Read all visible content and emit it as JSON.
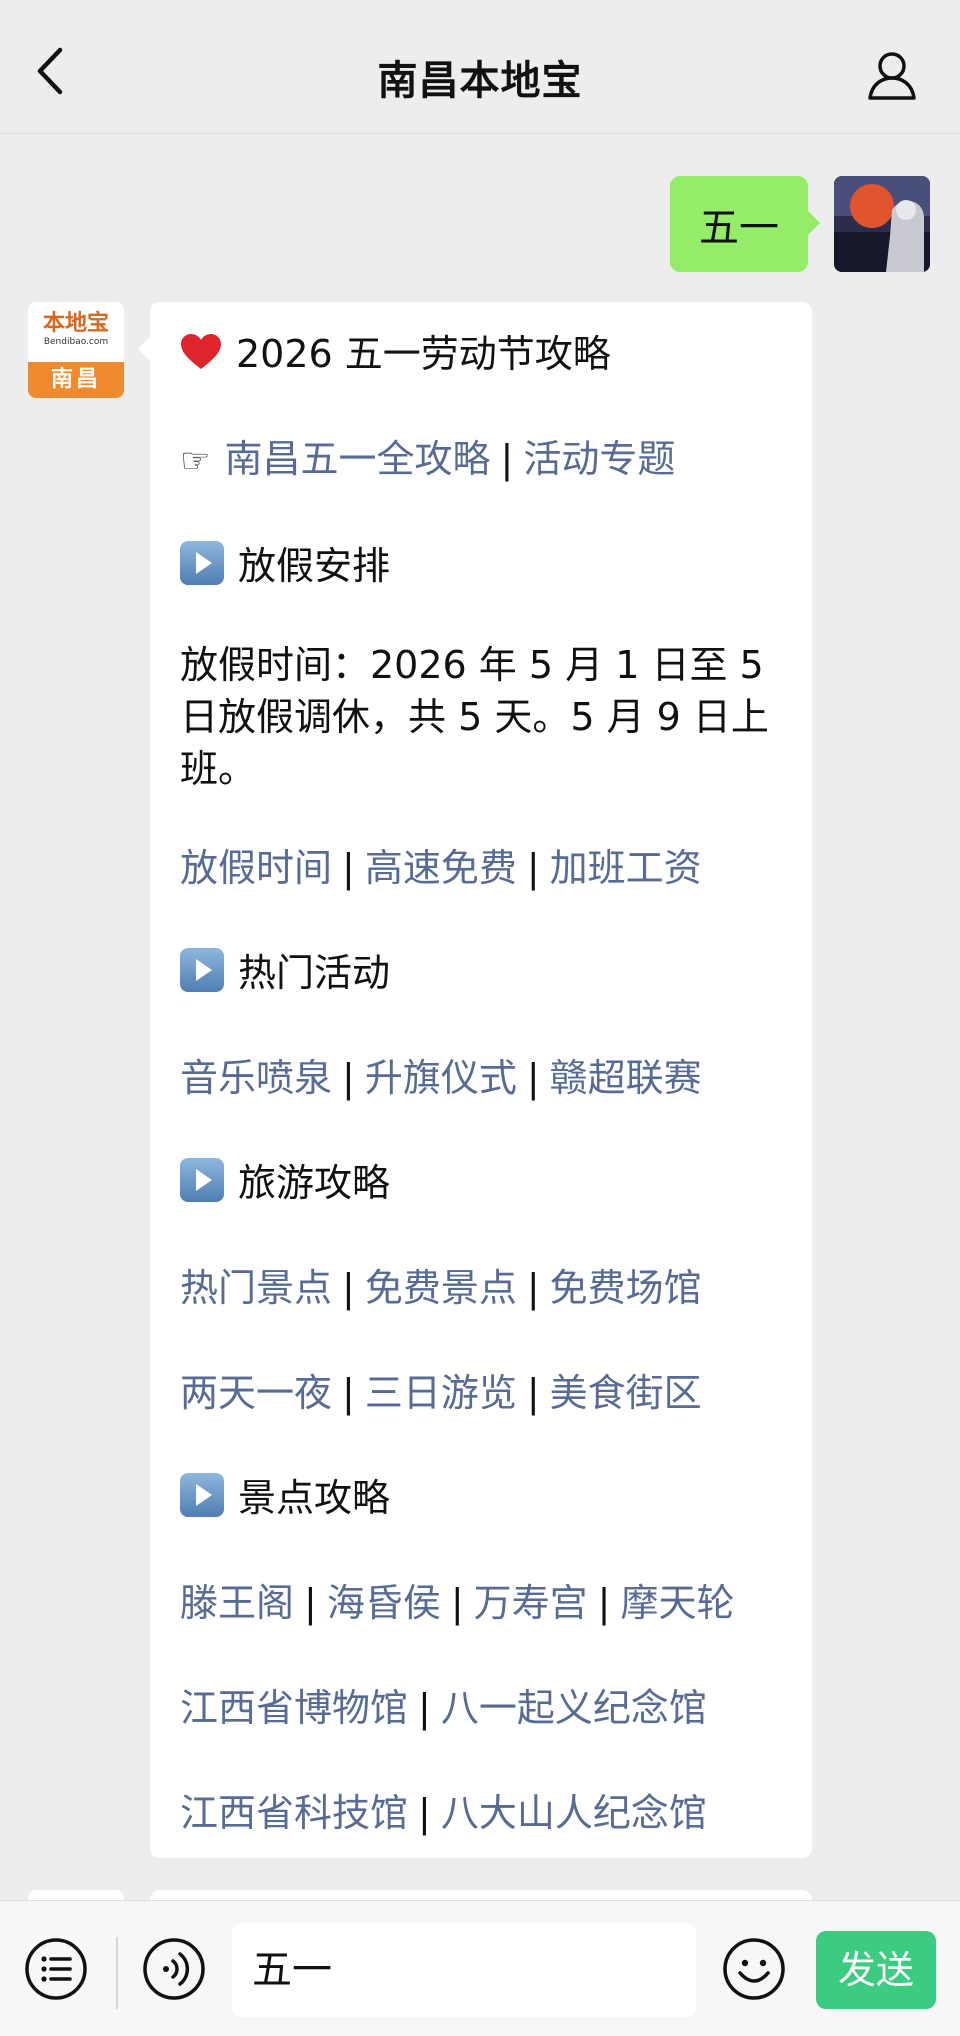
{
  "header": {
    "title": "南昌本地宝",
    "back_icon": "chevron-left-icon",
    "profile_icon": "person-icon"
  },
  "chat": {
    "user_message": {
      "text": "五一"
    },
    "bot_avatar": {
      "brand": "本地宝",
      "url": "Bendibao.com",
      "city": "南昌"
    },
    "bot_message": {
      "title": "2026 五一劳动节攻略",
      "guide_links": [
        "南昌五一全攻略",
        "活动专题"
      ],
      "sections": [
        {
          "heading": "放假安排",
          "paragraph": "放假时间：2026 年 5 月 1 日至 5 日放假调休，共 5 天。5 月 9 日上班。",
          "link_rows": [
            [
              "放假时间",
              "高速免费",
              "加班工资"
            ]
          ]
        },
        {
          "heading": "热门活动",
          "link_rows": [
            [
              "音乐喷泉",
              "升旗仪式",
              "赣超联赛"
            ]
          ]
        },
        {
          "heading": "旅游攻略",
          "link_rows": [
            [
              "热门景点",
              "免费景点",
              "免费场馆"
            ],
            [
              "两天一夜",
              "三日游览",
              "美食街区"
            ]
          ]
        },
        {
          "heading": "景点攻略",
          "link_rows": [
            [
              "滕王阁",
              "海昏侯",
              "万寿宫",
              "摩天轮"
            ],
            [
              "江西省博物馆",
              "八一起义纪念馆"
            ],
            [
              "江西省科技馆",
              "八大山人纪念馆"
            ]
          ]
        }
      ]
    }
  },
  "footer": {
    "input_value": "五一",
    "send_label": "发送",
    "accent_color": "#07c160"
  }
}
